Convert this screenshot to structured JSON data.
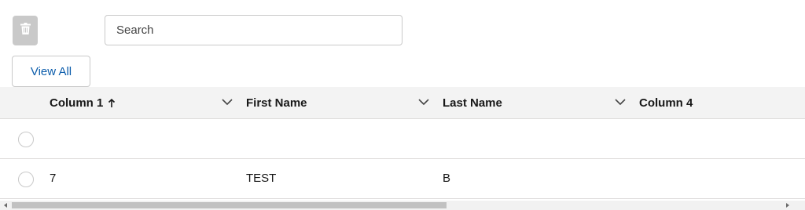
{
  "toolbar": {
    "delete_icon": "trash-icon",
    "search_placeholder": "Search",
    "search_value": "",
    "view_all_label": "View All"
  },
  "table": {
    "columns": [
      {
        "label": "Column 1",
        "sort": "ascending"
      },
      {
        "label": "First Name"
      },
      {
        "label": "Last Name"
      },
      {
        "label": "Column 4"
      }
    ],
    "rows": [
      {
        "selected": false,
        "cells": [
          "",
          "",
          "",
          ""
        ]
      },
      {
        "selected": false,
        "cells": [
          "7",
          "TEST",
          "B",
          ""
        ]
      }
    ]
  },
  "colors": {
    "accent": "#0b5cab",
    "header_bg": "#f3f3f3",
    "border": "#dddbda",
    "delete_button_bg": "#c9c9c9"
  }
}
